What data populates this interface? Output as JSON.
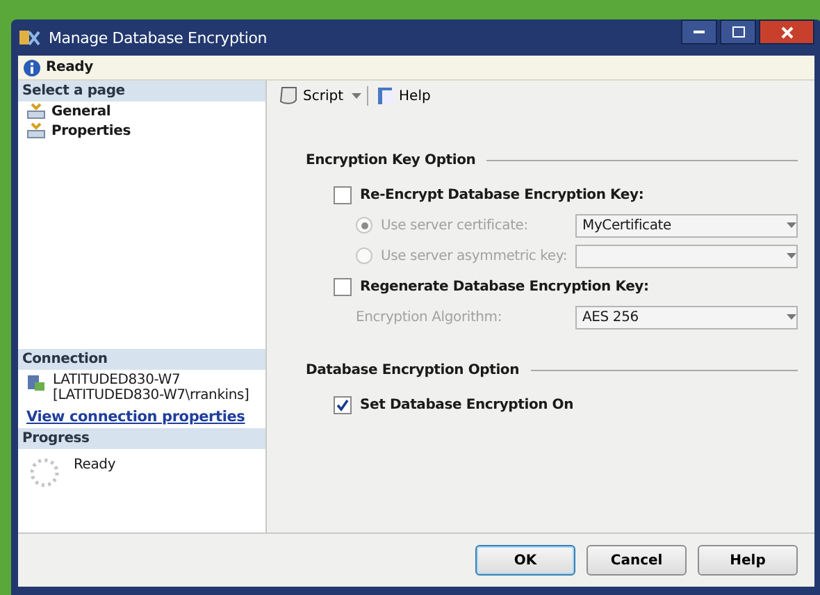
{
  "window": {
    "title": "Manage Database Encryption"
  },
  "status_bar": {
    "text": "Ready"
  },
  "sidebar": {
    "select_header": "Select a page",
    "pages": [
      {
        "label": "General"
      },
      {
        "label": "Properties"
      }
    ],
    "connection_header": "Connection",
    "server": "LATITUDED830-W7",
    "user": "[LATITUDED830-W7\\rrankins]",
    "link": "View connection properties",
    "progress_header": "Progress",
    "progress_text": "Ready"
  },
  "toolbar": {
    "script": "Script",
    "help": "Help"
  },
  "sections": [
    {
      "title": "Encryption Key Option",
      "items": [
        {
          "kind": "checkbox",
          "label": "Re-Encrypt Database Encryption Key:",
          "checked": false
        },
        {
          "kind": "radio",
          "label": "Use server certificate:",
          "selected": true,
          "disabled": true,
          "value": "MyCertificate"
        },
        {
          "kind": "radio",
          "label": "Use server asymmetric key:",
          "selected": false,
          "disabled": true
        },
        {
          "kind": "checkbox",
          "label": "Regenerate Database Encryption Key:",
          "checked": false
        },
        {
          "kind": "dropdown",
          "label": "Encryption Algorithm:",
          "disabled": true,
          "value": "AES 256"
        }
      ]
    },
    {
      "title": "Database Encryption Option",
      "items": [
        {
          "kind": "checkbox",
          "label": "Set Database Encryption On",
          "checked": true
        }
      ]
    }
  ],
  "buttons": [
    {
      "label": "OK",
      "selected": true
    },
    {
      "label": "Cancel",
      "selected": false
    },
    {
      "label": "Help",
      "selected": false
    }
  ]
}
